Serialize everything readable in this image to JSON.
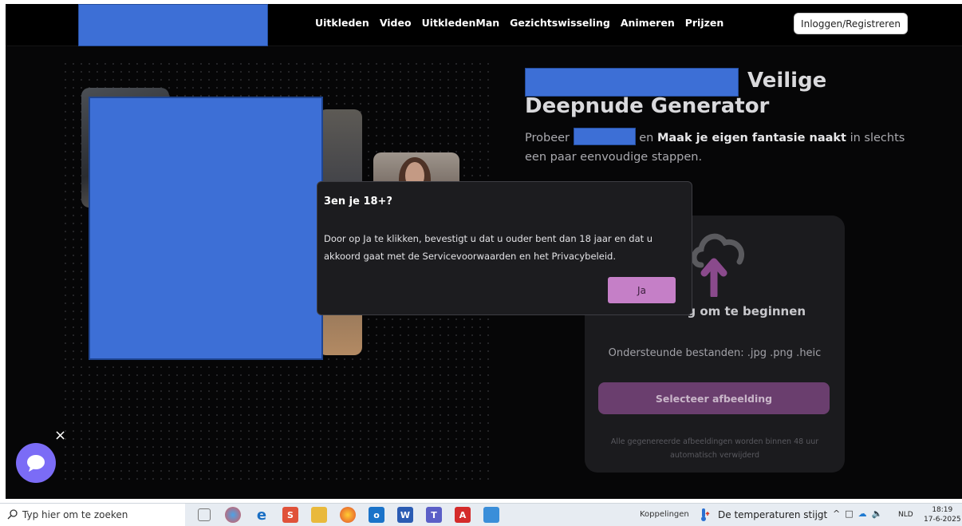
{
  "nav": {
    "links": [
      "Uitkleden",
      "Video",
      "UitkledenMan",
      "Gezichtswisseling",
      "Animeren",
      "Prijzen"
    ],
    "login_label": "Inloggen/Registreren"
  },
  "hero": {
    "title_part1": "Veilige",
    "title_part2": "Deepnude Generator",
    "subtitle_pre": "Probeer",
    "subtitle_mid": "en",
    "subtitle_bold": "Maak je eigen fantasie naakt",
    "subtitle_post": "in slechts een paar eenvoudige stappen."
  },
  "upload_card": {
    "title": "afbeelding om te beginnen",
    "supported": "Ondersteunde bestanden: .jpg .png .heic",
    "select_label": "Selecteer afbeelding",
    "note": "Alle gegenereerde afbeeldingen worden binnen 48 uur automatisch verwijderd"
  },
  "modal": {
    "title": "3en je 18+?",
    "body": "Door op Ja te klikken, bevestigt u dat u ouder bent dan 18 jaar en dat u akkoord gaat met de Servicevoorwaarden en het Privacybeleid.",
    "confirm_label": "Ja"
  },
  "chat": {
    "close_label": "×"
  },
  "taskbar": {
    "search_placeholder": "Typ hier om te zoeken",
    "links_label": "Koppelingen",
    "weather": "De temperaturen stijgt",
    "language": "NLD",
    "time": "18:19",
    "date": "17-6-2025"
  },
  "colors": {
    "accent": "#c57fc7",
    "redaction": "#3d6fd6",
    "page_bg": "#060607"
  }
}
